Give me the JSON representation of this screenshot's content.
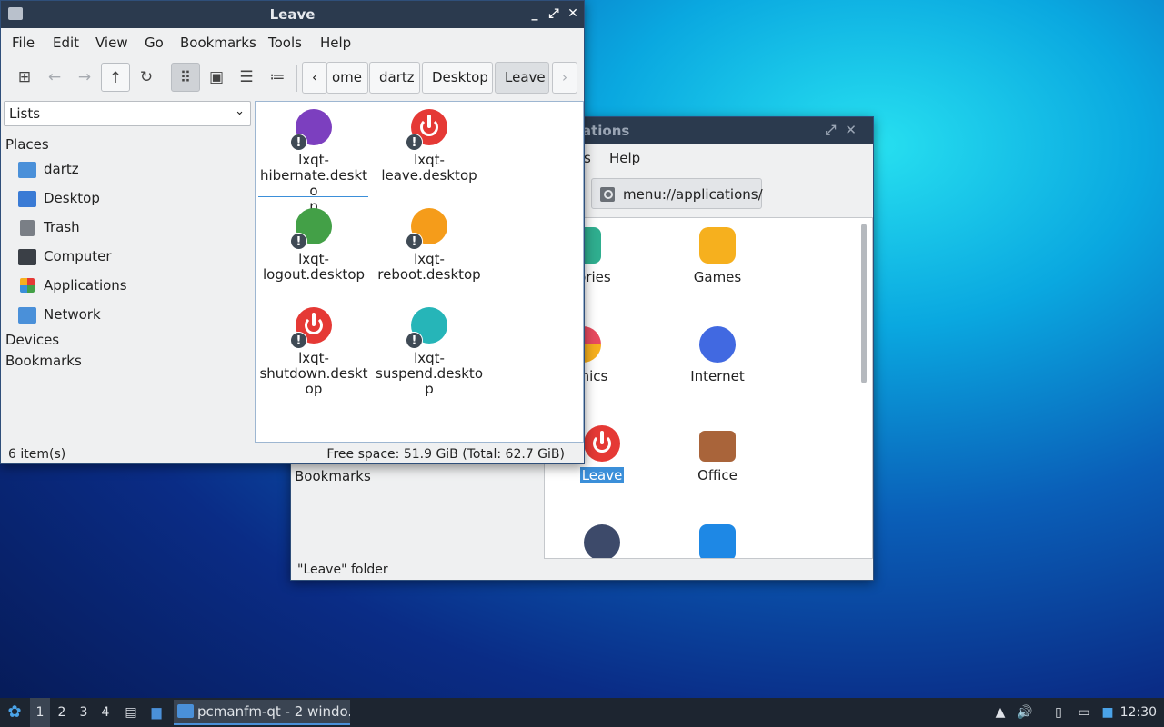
{
  "back_window": {
    "title": "ations",
    "menu": [
      "s",
      "Help"
    ],
    "path": "menu://applications/",
    "apps": [
      {
        "label": "essories",
        "icon": "accessories-icon",
        "color": "#2fae8f"
      },
      {
        "label": "Games",
        "icon": "games-icon",
        "color": "#f6b01e"
      },
      {
        "label": "raphics",
        "icon": "graphics-icon",
        "color": "#e84a5f"
      },
      {
        "label": "Internet",
        "icon": "internet-icon",
        "color": "#4169e1"
      },
      {
        "label": "Leave",
        "icon": "leave-icon",
        "color": "#e53935"
      },
      {
        "label": "Office",
        "icon": "office-icon",
        "color": "#a9643a"
      },
      {
        "label": "",
        "icon": "other-icon",
        "color": "#3d4a6a"
      },
      {
        "label": "",
        "icon": "settings-icon",
        "color": "#1e88e5"
      }
    ],
    "sidebar_bookmarks": "Bookmarks",
    "status": "\"Leave\" folder"
  },
  "front_window": {
    "title": "Leave",
    "menu": [
      "File",
      "Edit",
      "View",
      "Go",
      "Bookmarks",
      "Tools",
      "Help"
    ],
    "breadcrumbs": [
      "ome",
      "dartz",
      "Desktop",
      "Leave"
    ],
    "sidebar_mode": "Lists",
    "places_heading": "Places",
    "places": [
      {
        "label": "dartz",
        "icon": "home-folder-icon",
        "color": "#4a90d9"
      },
      {
        "label": "Desktop",
        "icon": "desktop-icon",
        "color": "#3a7bd5"
      },
      {
        "label": "Trash",
        "icon": "trash-icon",
        "color": "#7a7f86"
      },
      {
        "label": "Computer",
        "icon": "computer-icon",
        "color": "#3a3f46"
      },
      {
        "label": "Applications",
        "icon": "applications-icon",
        "color": "#e8a33a"
      },
      {
        "label": "Network",
        "icon": "network-icon",
        "color": "#4a90d9"
      }
    ],
    "devices_heading": "Devices",
    "bookmarks_heading": "Bookmarks",
    "files": [
      {
        "name": "lxqt-hibernate.desktop",
        "lines": [
          "lxqt-",
          "hibernate.deskto",
          "p"
        ],
        "color": "#7c3fbf"
      },
      {
        "name": "lxqt-leave.desktop",
        "lines": [
          "lxqt-",
          "leave.desktop"
        ],
        "color": "#e53935"
      },
      {
        "name": "lxqt-logout.desktop",
        "lines": [
          "lxqt-",
          "logout.desktop"
        ],
        "color": "#43a047"
      },
      {
        "name": "lxqt-reboot.desktop",
        "lines": [
          "lxqt-",
          "reboot.desktop"
        ],
        "color": "#f59c1a"
      },
      {
        "name": "lxqt-shutdown.desktop",
        "lines": [
          "lxqt-",
          "shutdown.deskt",
          "op"
        ],
        "color": "#e53935"
      },
      {
        "name": "lxqt-suspend.desktop",
        "lines": [
          "lxqt-",
          "suspend.desktop"
        ],
        "color": "#26b5b8"
      }
    ],
    "status_left": "6 item(s)",
    "status_right": "Free space: 51.9 GiB (Total: 62.7 GiB)"
  },
  "taskbar": {
    "workspaces": [
      "1",
      "2",
      "3",
      "4"
    ],
    "active_workspace": "1",
    "task_label": "pcmanfm-qt - 2 windo...",
    "clock": "12:30"
  }
}
